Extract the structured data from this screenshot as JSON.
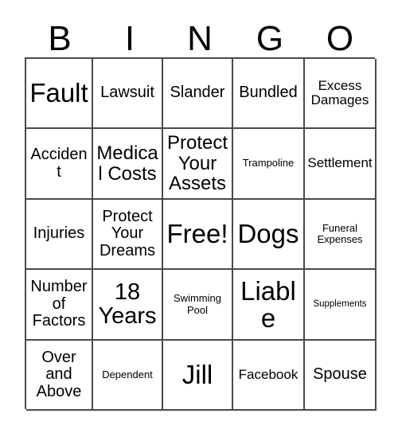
{
  "card": {
    "title": "BINGO",
    "header_letters": [
      "B",
      "I",
      "N",
      "G",
      "O"
    ],
    "grid_size": "5x5",
    "free_space": "Free!",
    "colors": {
      "text": "#000000",
      "grid_line": "#4a4a4a",
      "background": "#ffffff"
    },
    "rows": [
      [
        {
          "label": "Fault",
          "size": "fs-xxl"
        },
        {
          "label": "Lawsuit",
          "size": "fs-md"
        },
        {
          "label": "Slander",
          "size": "fs-md"
        },
        {
          "label": "Bundled",
          "size": "fs-md"
        },
        {
          "label": "Excess Damages",
          "size": "fs-sm"
        }
      ],
      [
        {
          "label": "Accident",
          "size": "fs-md"
        },
        {
          "label": "Medical Costs",
          "size": "fs-lg"
        },
        {
          "label": "Protect Your Assets",
          "size": "fs-lg"
        },
        {
          "label": "Trampoline",
          "size": "fs-xs"
        },
        {
          "label": "Settlement",
          "size": "fs-sm"
        }
      ],
      [
        {
          "label": "Injuries",
          "size": "fs-md"
        },
        {
          "label": "Protect Your Dreams",
          "size": "fs-md"
        },
        {
          "label": "Free!",
          "size": "fs-xxl"
        },
        {
          "label": "Dogs",
          "size": "fs-xxl"
        },
        {
          "label": "Funeral Expenses",
          "size": "fs-xs"
        }
      ],
      [
        {
          "label": "Number of Factors",
          "size": "fs-md"
        },
        {
          "label": "18 Years",
          "size": "fs-xl"
        },
        {
          "label": "Swimming Pool",
          "size": "fs-xs"
        },
        {
          "label": "Liable",
          "size": "fs-xxl"
        },
        {
          "label": "Supplements",
          "size": "fs-xxs"
        }
      ],
      [
        {
          "label": "Over and Above",
          "size": "fs-md"
        },
        {
          "label": "Dependent",
          "size": "fs-xs"
        },
        {
          "label": "Jill",
          "size": "fs-xxl"
        },
        {
          "label": "Facebook",
          "size": "fs-sm"
        },
        {
          "label": "Spouse",
          "size": "fs-md"
        }
      ]
    ]
  }
}
